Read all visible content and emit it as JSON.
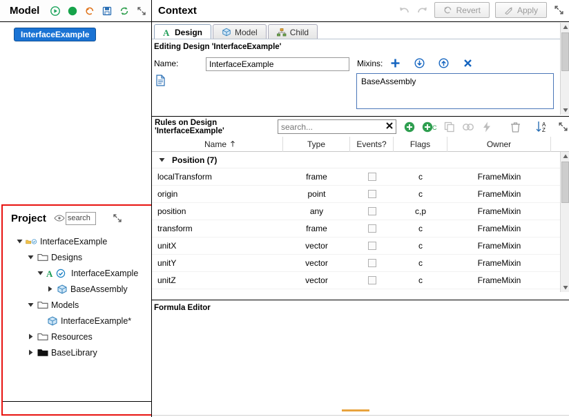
{
  "model_panel": {
    "title": "Model",
    "toolbar": [
      {
        "name": "run-icon",
        "color": "#1aa35a"
      },
      {
        "name": "stop-icon",
        "color": "#16a34a"
      },
      {
        "name": "reset-icon",
        "color": "#e0731a"
      },
      {
        "name": "save-icon",
        "color": "#2a6fb5"
      },
      {
        "name": "refresh-icon",
        "color": "#2a9d4a"
      },
      {
        "name": "expand-icon",
        "color": "#555555"
      }
    ],
    "chip_label": "InterfaceExample",
    "chip_color": "#1a73d4"
  },
  "project_panel": {
    "title": "Project",
    "eye_icon": "visibility-icon",
    "search_value": "search",
    "expand_icon": "expand-icon",
    "border_color": "#e8120f",
    "tree": [
      {
        "label": "InterfaceExample",
        "depth": 0,
        "twisty": "down",
        "icon": "folder-open-check-icon"
      },
      {
        "label": "Designs",
        "depth": 1,
        "twisty": "down",
        "icon": "folder-icon"
      },
      {
        "label": "InterfaceExample",
        "depth": 2,
        "twisty": "down",
        "icon": "design-check-icon"
      },
      {
        "label": "BaseAssembly",
        "depth": 3,
        "twisty": "right",
        "icon": "box-icon"
      },
      {
        "label": "Models",
        "depth": 1,
        "twisty": "down",
        "icon": "folder-icon"
      },
      {
        "label": "InterfaceExample*",
        "depth": 2,
        "twisty": "none",
        "icon": "model-icon"
      },
      {
        "label": "Resources",
        "depth": 1,
        "twisty": "right",
        "icon": "folder-icon"
      },
      {
        "label": "BaseLibrary",
        "depth": 1,
        "twisty": "right",
        "icon": "folder-dark-icon"
      }
    ]
  },
  "context_panel": {
    "title": "Context",
    "header_buttons": {
      "undo_icon": "undo-icon",
      "redo_icon": "redo-icon",
      "revert_label": "Revert",
      "apply_label": "Apply",
      "expand_icon": "expand-icon"
    },
    "tabs": [
      {
        "label": "Design",
        "icon": "design-a-icon",
        "active": true
      },
      {
        "label": "Model",
        "icon": "model-cube-icon",
        "active": false
      },
      {
        "label": "Child",
        "icon": "child-tree-icon",
        "active": false
      }
    ],
    "design": {
      "editing_label": "Editing Design 'InterfaceExample'",
      "name_label": "Name:",
      "name_value": "InterfaceExample",
      "doc_icon": "document-icon",
      "mixins_label": "Mixins:",
      "mixins_tools": [
        {
          "name": "add-mixin-icon",
          "glyph": "+",
          "color": "#1565c0"
        },
        {
          "name": "import-mixin-icon",
          "color": "#1565c0"
        },
        {
          "name": "export-mixin-icon",
          "color": "#1565c0"
        },
        {
          "name": "remove-mixin-icon",
          "glyph": "✖",
          "color": "#1565c0"
        }
      ],
      "mixins_items": [
        "BaseAssembly"
      ]
    },
    "rules": {
      "title": "Rules on Design 'InterfaceExample'",
      "search_placeholder": "search...",
      "search_value": "",
      "clear_icon": "clear-icon",
      "tools": [
        {
          "name": "add-rule-icon",
          "color": "#2e9e4f"
        },
        {
          "name": "add-child-rule-icon",
          "color": "#2e9e4f"
        },
        {
          "name": "copy-rule-icon",
          "color": "#b7b7b7"
        },
        {
          "name": "link-rule-icon",
          "color": "#b7b7b7"
        },
        {
          "name": "event-rule-icon",
          "color": "#b7b7b7"
        },
        {
          "name": "delete-rule-icon",
          "color": "#a0a0a0"
        },
        {
          "name": "sort-az-icon",
          "color": "#2a6fb5"
        },
        {
          "name": "expand-rules-icon",
          "color": "#555555"
        }
      ],
      "columns": [
        "Name",
        "Type",
        "Events?",
        "Flags",
        "Owner"
      ],
      "sort_column": "Name",
      "sort_direction": "asc",
      "group": {
        "label": "Position (7)",
        "expanded": true
      },
      "rows": [
        {
          "name": "localTransform",
          "type": "frame",
          "events": false,
          "flags": "c",
          "owner": "FrameMixin"
        },
        {
          "name": "origin",
          "type": "point",
          "events": false,
          "flags": "c",
          "owner": "FrameMixin"
        },
        {
          "name": "position",
          "type": "any",
          "events": false,
          "flags": "c,p",
          "owner": "FrameMixin"
        },
        {
          "name": "transform",
          "type": "frame",
          "events": false,
          "flags": "c",
          "owner": "FrameMixin"
        },
        {
          "name": "unitX",
          "type": "vector",
          "events": false,
          "flags": "c",
          "owner": "FrameMixin"
        },
        {
          "name": "unitY",
          "type": "vector",
          "events": false,
          "flags": "c",
          "owner": "FrameMixin"
        },
        {
          "name": "unitZ",
          "type": "vector",
          "events": false,
          "flags": "c",
          "owner": "FrameMixin"
        }
      ]
    },
    "formula_editor": {
      "title": "Formula Editor",
      "content": ""
    }
  }
}
